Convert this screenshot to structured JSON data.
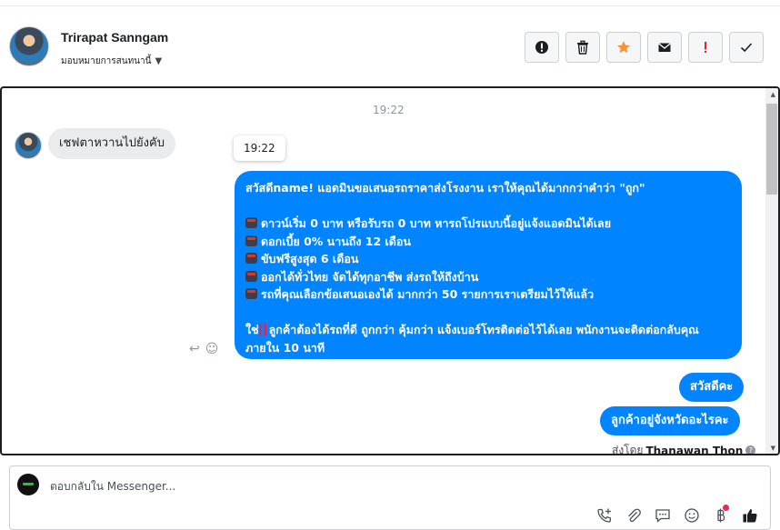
{
  "header": {
    "contact_name": "Trirapat Sanngam",
    "assign_label": "มอบหมายการสนทนานี้",
    "actions": [
      {
        "icon": "alert-circle-icon",
        "color": "#1c1e21"
      },
      {
        "icon": "trash-icon",
        "color": "#1c1e21"
      },
      {
        "icon": "star-icon",
        "color": "#f7923b"
      },
      {
        "icon": "envelope-icon",
        "color": "#1c1e21"
      },
      {
        "icon": "exclamation-icon",
        "color": "#e02424"
      },
      {
        "icon": "checkmark-icon",
        "color": "#1c1e21"
      }
    ]
  },
  "conversation": {
    "timestamp": "19:22",
    "incoming_message": "เชฟตาหวานไปยังคับ",
    "tooltip_time": "19:22",
    "outgoing_long": {
      "intro": "สวัสดีname! แอดมินขอเสนอรถราคาส่งโรงงาน เราให้คุณได้มากกว่าคำว่า \"ถูก\"",
      "bullets": [
        "ดาวน์เริ่ม 0 บาท หรือรับรถ 0 บาท หารถโปรแบบนี้อยู่แจ้งแอดมินได้เลย",
        "ดอกเบี้ย 0% นานถึง 12 เดือน",
        "ขับฟรีสูงสุด 6 เดือน",
        "ออกได้ทั่วไทย จัดได้ทุกอาชีพ ส่งรถให้ถึงบ้าน",
        "รถที่คุณเลือกข้อเสนอเองได้ มากกว่า 50 รายการเราเตรียมไว้ให้แล้ว"
      ],
      "closing_prefix": "ใช่",
      "closing": "ลูกค้าต้องได้รถที่ดี ถูกกว่า คุ้มกว่า แจ้งเบอร์โทรติดต่อไว้ได้เลย พนักงานจะติดต่อกลับคุณภายใน 10 นาที"
    },
    "outgoing_short": [
      "สวัสดีคะ",
      "ลูกค้าอยู่จังหวัดอะไรคะ"
    ],
    "sent_by_label": "ส่งโดย",
    "sent_by_name": "Thanawan Thon"
  },
  "composer": {
    "placeholder": "ตอบกลับใน Messenger...",
    "tools": [
      "phone-add-icon",
      "paperclip-icon",
      "saved-reply-icon",
      "emoji-icon",
      "baht-icon",
      "thumbs-up-icon"
    ]
  },
  "colors": {
    "accent_blue": "#0084ff",
    "incoming_bubble": "#e9ebee",
    "notification_dot": "#f02849"
  }
}
